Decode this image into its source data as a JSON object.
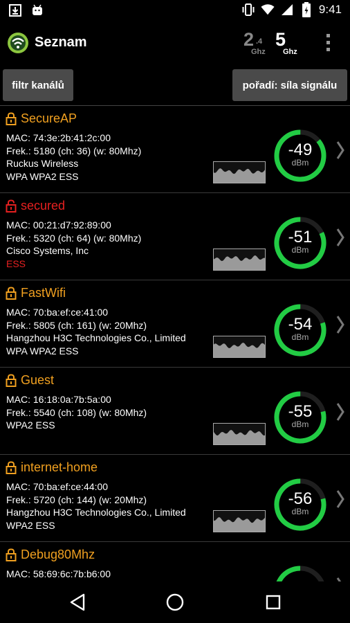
{
  "status_bar": {
    "time": "9:41",
    "left_icons": [
      "download-icon",
      "android-icon"
    ],
    "right_icons": [
      "vibrate-icon",
      "wifi-icon",
      "signal-icon",
      "battery-icon"
    ]
  },
  "app_bar": {
    "title": "Seznam",
    "band_24": {
      "main": "2",
      "sub": ".4",
      "unit": "Ghz",
      "active": false
    },
    "band_5": {
      "main": "5",
      "unit": "Ghz",
      "active": true
    }
  },
  "filters": {
    "channel_filter_label": "filtr kanálů",
    "order_label": "pořadí: síla signálu"
  },
  "colors": {
    "accent_orange": "#f0a020",
    "alert_red": "#e62020",
    "gauge_green": "#22cc44",
    "button_gray": "#4a4a4a"
  },
  "networks": [
    {
      "ssid": "SecureAP",
      "ssid_color": "orange",
      "lock_icon": "lock-closed-icon",
      "mac": "MAC: 74:3e:2b:41:2c:00",
      "freq": "Frek.: 5180 (ch: 36) (w: 80Mhz)",
      "vendor": "Ruckus Wireless",
      "security": "WPA  WPA2  ESS",
      "security_red": false,
      "signal": "-49",
      "unit": "dBm",
      "signal_fraction": 0.86
    },
    {
      "ssid": "secured",
      "ssid_color": "red",
      "lock_icon": "lock-open-icon",
      "mac": "MAC: 00:21:d7:92:89:00",
      "freq": "Frek.: 5320 (ch: 64) (w: 80Mhz)",
      "vendor": "Cisco Systems, Inc",
      "security": "ESS",
      "security_red": true,
      "signal": "-51",
      "unit": "dBm",
      "signal_fraction": 0.82
    },
    {
      "ssid": "FastWifi",
      "ssid_color": "orange",
      "lock_icon": "lock-closed-icon",
      "mac": "MAC: 70:ba:ef:ce:41:00",
      "freq": "Frek.: 5805 (ch: 161) (w: 20Mhz)",
      "vendor": "Hangzhou H3C Technologies Co., Limited",
      "security": "WPA  WPA2  ESS",
      "security_red": false,
      "signal": "-54",
      "unit": "dBm",
      "signal_fraction": 0.8
    },
    {
      "ssid": "Guest",
      "ssid_color": "orange",
      "lock_icon": "lock-closed-icon",
      "mac": "MAC: 16:18:0a:7b:5a:00",
      "freq": "Frek.: 5540 (ch: 108) (w: 80Mhz)",
      "vendor": "",
      "security": "WPA2  ESS",
      "security_red": false,
      "signal": "-55",
      "unit": "dBm",
      "signal_fraction": 0.79
    },
    {
      "ssid": "internet-home",
      "ssid_color": "orange",
      "lock_icon": "lock-closed-icon",
      "mac": "MAC: 70:ba:ef:ce:44:00",
      "freq": "Frek.: 5720 (ch: 144) (w: 20Mhz)",
      "vendor": "Hangzhou H3C Technologies Co., Limited",
      "security": "WPA2  ESS",
      "security_red": false,
      "signal": "-56",
      "unit": "dBm",
      "signal_fraction": 0.79
    },
    {
      "ssid": "Debug80Mhz",
      "ssid_color": "orange",
      "lock_icon": "lock-closed-icon",
      "mac": "MAC: 58:69:6c:7b:b6:00",
      "freq": "",
      "vendor": "",
      "security": "",
      "security_red": false,
      "signal": "",
      "unit": "",
      "signal_fraction": 0.3
    }
  ],
  "nav_bar": {
    "icons": [
      "back-icon",
      "home-icon",
      "recent-apps-icon"
    ]
  }
}
